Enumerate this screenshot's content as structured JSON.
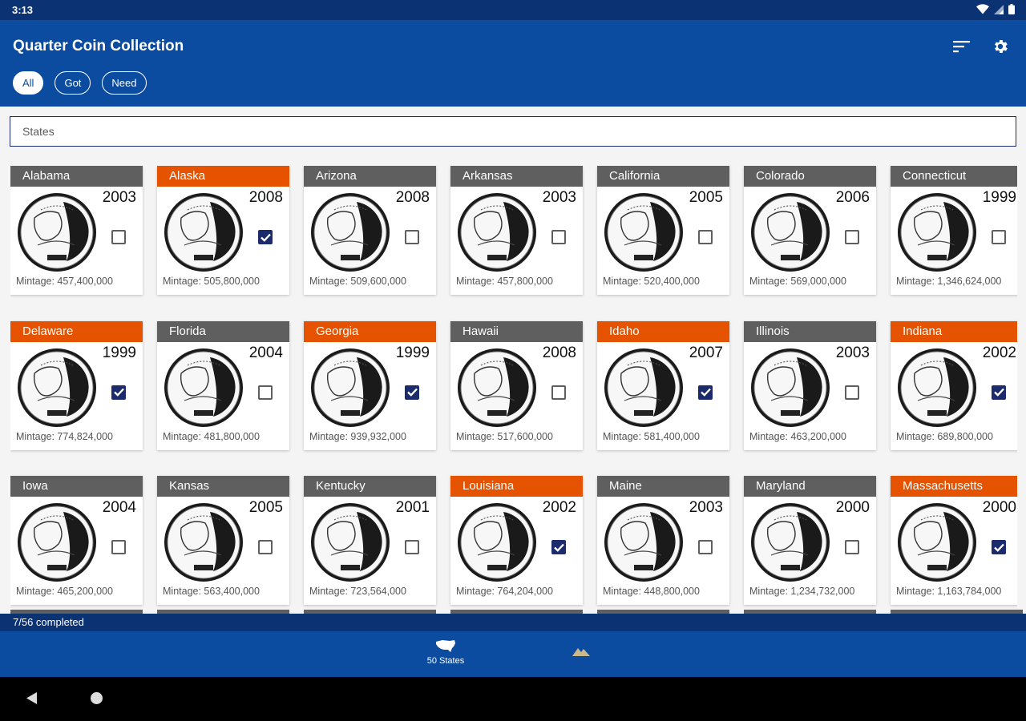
{
  "status_bar": {
    "time": "3:13"
  },
  "app_bar": {
    "title": "Quarter Coin Collection",
    "sort_icon": "sort-icon",
    "settings_icon": "gear-icon",
    "filters": [
      {
        "label": "All",
        "active": true
      },
      {
        "label": "Got",
        "active": false
      },
      {
        "label": "Need",
        "active": false
      }
    ]
  },
  "search": {
    "placeholder": "States"
  },
  "coins": [
    {
      "name": "Alabama",
      "year": "2003",
      "owned": false,
      "mintage": "Mintage: 457,400,000"
    },
    {
      "name": "Alaska",
      "year": "2008",
      "owned": true,
      "mintage": "Mintage: 505,800,000"
    },
    {
      "name": "Arizona",
      "year": "2008",
      "owned": false,
      "mintage": "Mintage: 509,600,000"
    },
    {
      "name": "Arkansas",
      "year": "2003",
      "owned": false,
      "mintage": "Mintage: 457,800,000"
    },
    {
      "name": "California",
      "year": "2005",
      "owned": false,
      "mintage": "Mintage: 520,400,000"
    },
    {
      "name": "Colorado",
      "year": "2006",
      "owned": false,
      "mintage": "Mintage: 569,000,000"
    },
    {
      "name": "Connecticut",
      "year": "1999",
      "owned": false,
      "mintage": "Mintage: 1,346,624,000"
    },
    {
      "name": "Delaware",
      "year": "1999",
      "owned": true,
      "mintage": "Mintage: 774,824,000"
    },
    {
      "name": "Florida",
      "year": "2004",
      "owned": false,
      "mintage": "Mintage: 481,800,000"
    },
    {
      "name": "Georgia",
      "year": "1999",
      "owned": true,
      "mintage": "Mintage: 939,932,000"
    },
    {
      "name": "Hawaii",
      "year": "2008",
      "owned": false,
      "mintage": "Mintage: 517,600,000"
    },
    {
      "name": "Idaho",
      "year": "2007",
      "owned": true,
      "mintage": "Mintage: 581,400,000"
    },
    {
      "name": "Illinois",
      "year": "2003",
      "owned": false,
      "mintage": "Mintage: 463,200,000"
    },
    {
      "name": "Indiana",
      "year": "2002",
      "owned": true,
      "mintage": "Mintage: 689,800,000"
    },
    {
      "name": "Iowa",
      "year": "2004",
      "owned": false,
      "mintage": "Mintage: 465,200,000"
    },
    {
      "name": "Kansas",
      "year": "2005",
      "owned": false,
      "mintage": "Mintage: 563,400,000"
    },
    {
      "name": "Kentucky",
      "year": "2001",
      "owned": false,
      "mintage": "Mintage: 723,564,000"
    },
    {
      "name": "Louisiana",
      "year": "2002",
      "owned": true,
      "mintage": "Mintage: 764,204,000"
    },
    {
      "name": "Maine",
      "year": "2003",
      "owned": false,
      "mintage": "Mintage: 448,800,000"
    },
    {
      "name": "Maryland",
      "year": "2000",
      "owned": false,
      "mintage": "Mintage: 1,234,732,000"
    },
    {
      "name": "Massachusetts",
      "year": "2000",
      "owned": true,
      "mintage": "Mintage: 1,163,784,000"
    }
  ],
  "progress": {
    "text": "7/56 completed"
  },
  "bottom_nav": {
    "items": [
      {
        "label": "50 States",
        "icon": "us-map-icon",
        "selected": true
      },
      {
        "icon": "mountain-icon",
        "selected": false
      }
    ]
  },
  "colors": {
    "owned_header": "#e55200",
    "need_header": "#5f5f5f",
    "app_bar": "#0b4ba0",
    "status_bar": "#0b3272"
  }
}
